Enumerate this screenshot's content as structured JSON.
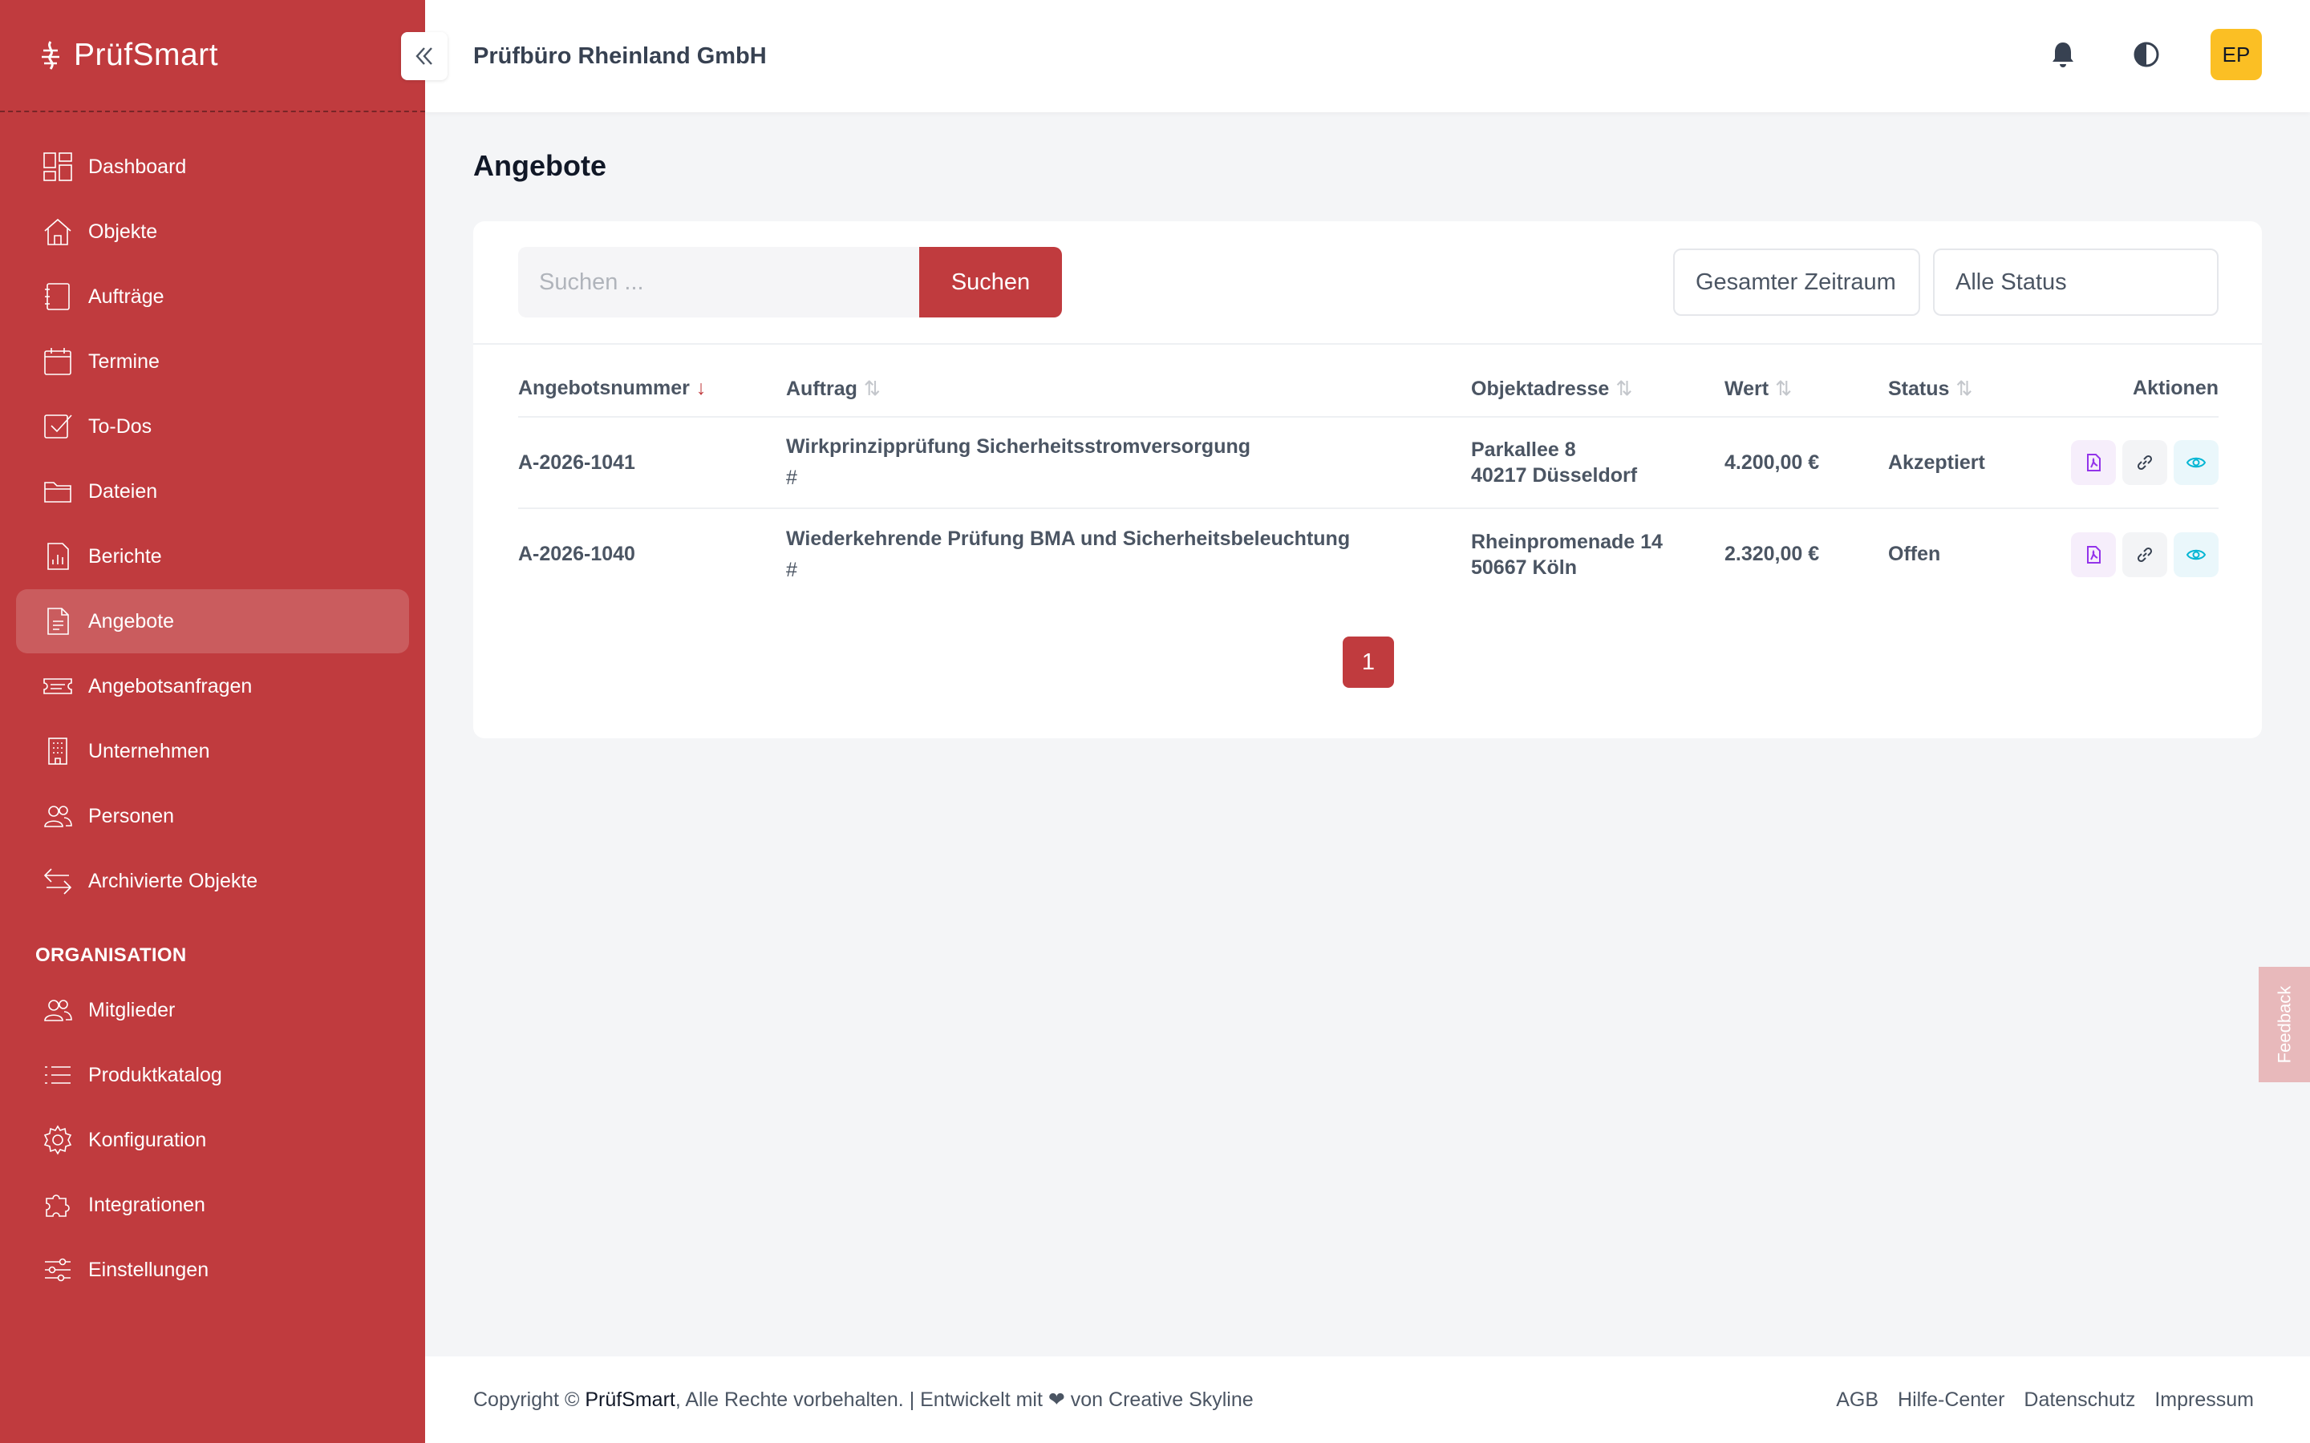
{
  "brand": {
    "name": "PrüfSmart"
  },
  "header": {
    "org_name": "Prüfbüro Rheinland GmbH",
    "avatar": "EP"
  },
  "sidebar": {
    "items": [
      {
        "label": "Dashboard",
        "icon": "dashboard-icon"
      },
      {
        "label": "Objekte",
        "icon": "home-icon"
      },
      {
        "label": "Aufträge",
        "icon": "notebook-icon"
      },
      {
        "label": "Termine",
        "icon": "calendar-icon"
      },
      {
        "label": "To-Dos",
        "icon": "checkbox-icon"
      },
      {
        "label": "Dateien",
        "icon": "folder-icon"
      },
      {
        "label": "Berichte",
        "icon": "report-icon"
      },
      {
        "label": "Angebote",
        "icon": "document-icon",
        "active": true
      },
      {
        "label": "Angebotsanfragen",
        "icon": "ticket-icon"
      },
      {
        "label": "Unternehmen",
        "icon": "building-icon"
      },
      {
        "label": "Personen",
        "icon": "users-icon"
      },
      {
        "label": "Archivierte Objekte",
        "icon": "archive-arrows-icon"
      }
    ],
    "section_title": "ORGANISATION",
    "org_items": [
      {
        "label": "Mitglieder",
        "icon": "users-icon"
      },
      {
        "label": "Produktkatalog",
        "icon": "list-icon"
      },
      {
        "label": "Konfiguration",
        "icon": "gear-icon"
      },
      {
        "label": "Integrationen",
        "icon": "puzzle-icon"
      },
      {
        "label": "Einstellungen",
        "icon": "sliders-icon"
      }
    ]
  },
  "main": {
    "title": "Angebote",
    "search": {
      "placeholder": "Suchen ...",
      "button": "Suchen"
    },
    "filters": {
      "period": "Gesamter Zeitraum",
      "status": "Alle Status"
    },
    "columns": [
      "Angebotsnummer",
      "Auftrag",
      "Objektadresse",
      "Wert",
      "Status",
      "Aktionen"
    ],
    "rows": [
      {
        "number": "A-2026-1041",
        "order": "Wirkprinzipprüfung Sicherheitsstromversorgung",
        "order_sub": "#",
        "street": "Parkallee 8",
        "city": "40217 Düsseldorf",
        "value": "4.200,00 €",
        "status": "Akzeptiert"
      },
      {
        "number": "A-2026-1040",
        "order": "Wiederkehrende Prüfung BMA und Sicherheitsbeleuchtung",
        "order_sub": "#",
        "street": "Rheinpromenade 14",
        "city": "50667 Köln",
        "value": "2.320,00 €",
        "status": "Offen"
      }
    ],
    "pagination": {
      "current": "1"
    }
  },
  "feedback": "Feedback",
  "footer": {
    "copyright_prefix": "Copyright © ",
    "brand": "PrüfSmart",
    "copyright_suffix": ", Alle Rechte vorbehalten. | Entwickelt mit ❤ von Creative Skyline",
    "links": [
      "AGB",
      "Hilfe-Center",
      "Datenschutz",
      "Impressum"
    ]
  },
  "colors": {
    "brand": "#c03b3e",
    "avatar": "#fbbf24",
    "pdf": "#9333ea",
    "view": "#06b6d4"
  }
}
